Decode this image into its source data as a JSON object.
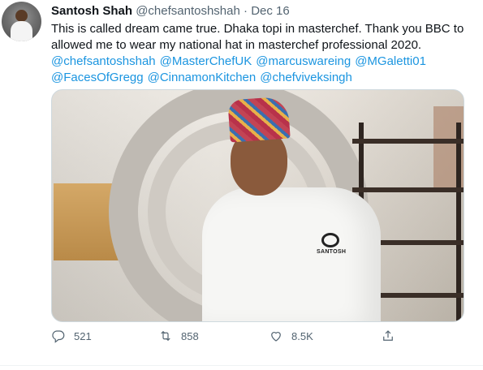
{
  "tweet": {
    "author_name": "Santosh Shah",
    "handle": "@chefsantoshshah",
    "separator": "·",
    "date": "Dec 16",
    "text_line1": "This is called dream came true. Dhaka topi in masterchef. Thank you BBC to",
    "text_line2": "allowed me to wear my national hat in masterchef professional 2020.",
    "mentions": [
      "@chefsantoshshah",
      "@MasterChefUK",
      "@marcuswareing",
      "@MGaletti01",
      "@FacesOfGregg",
      "@CinnamonKitchen",
      "@chefviveksingh"
    ],
    "badge_name": "SANTOSH"
  },
  "actions": {
    "reply_count": "521",
    "retweet_count": "858",
    "like_count": "8.5K"
  },
  "icons": [
    "reply-icon",
    "retweet-icon",
    "like-icon",
    "share-icon"
  ],
  "colors": {
    "link": "#1b95e0",
    "muted": "#536471",
    "text": "#0f1419"
  }
}
